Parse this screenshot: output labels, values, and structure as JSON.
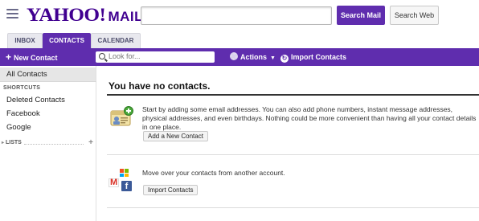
{
  "header": {
    "logo_main": "YAHOO!",
    "logo_sub": "MAIL",
    "search_value": "",
    "search_mail_label": "Search Mail",
    "search_web_label": "Search Web"
  },
  "tabs": [
    {
      "label": "INBOX",
      "active": false
    },
    {
      "label": "CONTACTS",
      "active": true
    },
    {
      "label": "CALENDAR",
      "active": false
    }
  ],
  "toolbar": {
    "new_contact_label": "New Contact",
    "look_for_placeholder": "Look for...",
    "actions_label": "Actions",
    "import_label": "Import Contacts"
  },
  "sidebar": {
    "all_contacts": "All Contacts",
    "shortcuts_heading": "SHORTCUTS",
    "shortcuts": [
      "Deleted Contacts",
      "Facebook",
      "Google"
    ],
    "lists_heading": "LISTS"
  },
  "main": {
    "title": "You have no contacts.",
    "intro_text": "Start by adding some email addresses. You can also add phone numbers, instant message addresses, physical addresses, and even birthdays. Nothing could be more convenient than having all your contact details in one place.",
    "add_button": "Add a New Contact",
    "import_text": "Move over your contacts from another account.",
    "import_button": "Import Contacts"
  },
  "colors": {
    "brand_purple": "#5f2dae",
    "logo_purple": "#400090"
  }
}
